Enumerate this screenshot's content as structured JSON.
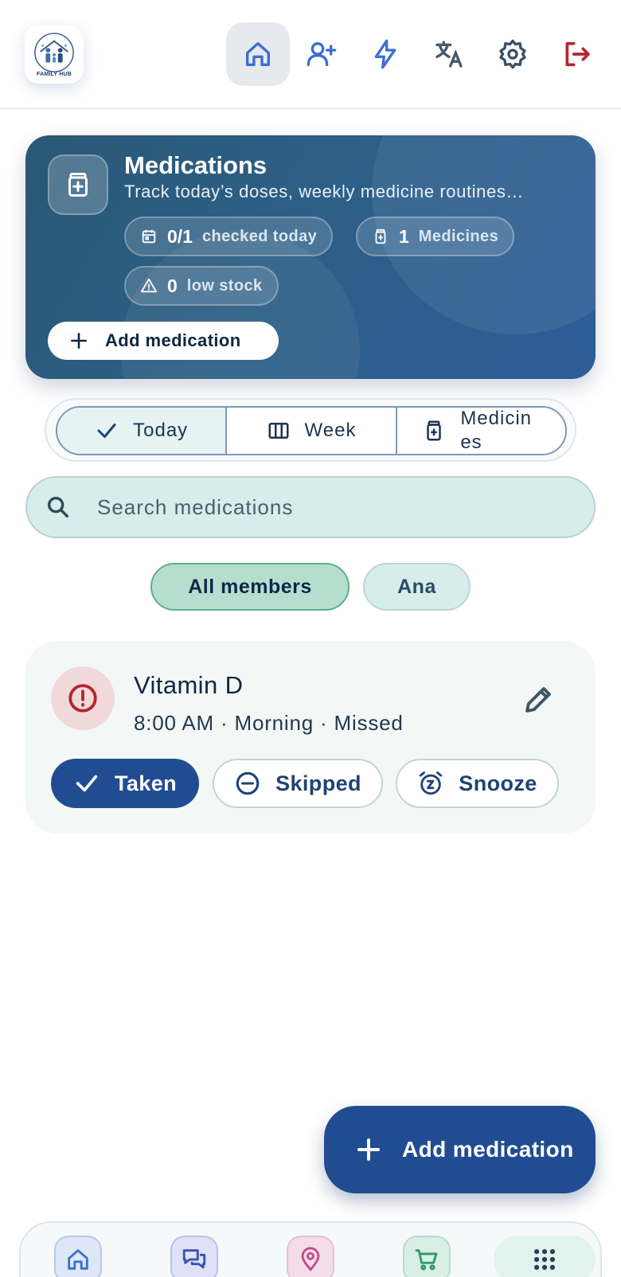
{
  "app": {
    "logo_text": "FAMILY HUB"
  },
  "topnav": {
    "items": [
      {
        "icon": "home-icon",
        "active": true
      },
      {
        "icon": "add-user-icon"
      },
      {
        "icon": "bolt-icon"
      },
      {
        "icon": "translate-icon"
      },
      {
        "icon": "gear-icon"
      },
      {
        "icon": "logout-icon"
      }
    ]
  },
  "hero": {
    "title": "Medications",
    "subtitle": "Track today’s doses, weekly medicine routines…",
    "chips": {
      "checked": {
        "value": "0/1",
        "label": "checked today"
      },
      "medicines": {
        "value": "1",
        "label": "Medicines"
      },
      "low_stock": {
        "value": "0",
        "label": "low stock"
      }
    },
    "add_button": "Add medication"
  },
  "tabs": [
    {
      "label": "Today",
      "icon": "check-icon",
      "active": true
    },
    {
      "label": "Week",
      "icon": "columns-icon"
    },
    {
      "label_line1": "Medicin",
      "label_line2": "es",
      "icon": "medicine-bottle-icon"
    }
  ],
  "search": {
    "placeholder": "Search medications"
  },
  "members": {
    "all": "All members",
    "ana": "Ana"
  },
  "med_card": {
    "name": "Vitamin D",
    "meta": "8:00 AM · Morning · Missed",
    "actions": {
      "taken": "Taken",
      "skipped": "Skipped",
      "snooze": "Snooze"
    }
  },
  "fab": {
    "label": "Add medication"
  },
  "colors": {
    "primary": "#224c92",
    "danger": "#b3262d",
    "accent_teal": "#d6eeeb",
    "icon_blue": "#3b6fd0"
  }
}
